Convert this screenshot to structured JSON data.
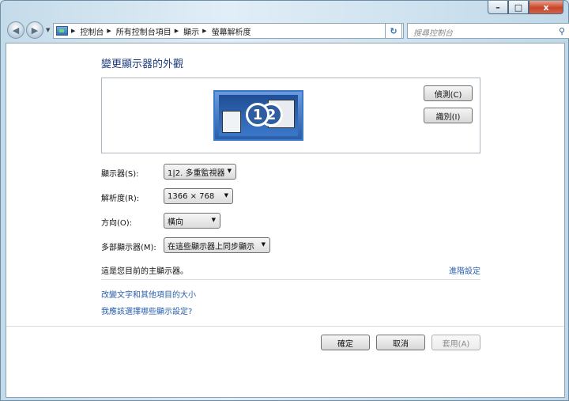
{
  "window": {
    "caption_buttons": {
      "minimize": "–",
      "maximize": "□",
      "close": "x"
    }
  },
  "nav": {
    "back_icon": "◀",
    "forward_icon": "▶",
    "breadcrumb": [
      "控制台",
      "所有控制台項目",
      "顯示",
      "螢幕解析度"
    ],
    "refresh_icon": "↻",
    "search_placeholder": "搜尋控制台",
    "search_icon": "⚲"
  },
  "main": {
    "title": "變更顯示器的外觀",
    "preview": {
      "monitor_labels": [
        "1",
        "2"
      ]
    },
    "detect_button": "偵測(C)",
    "identify_button": "識別(I)",
    "settings": [
      {
        "label": "顯示器(S):",
        "value": "1|2. 多重監視器"
      },
      {
        "label": "解析度(R):",
        "value": "1366 × 768"
      },
      {
        "label": "方向(O):",
        "value": "橫向"
      },
      {
        "label": "多部顯示器(M):",
        "value": "在這些顯示器上同步顯示"
      }
    ],
    "status_text": "這是您目前的主顯示器。",
    "advanced_link": "進階設定",
    "links": [
      "改變文字和其他項目的大小",
      "我應該選擇哪些顯示設定?"
    ]
  },
  "footer": {
    "ok": "確定",
    "cancel": "取消",
    "apply": "套用(A)"
  },
  "colors": {
    "link": "#2a5fab",
    "title": "#1c3a7a",
    "monitor_accent": "#2e5da0"
  }
}
